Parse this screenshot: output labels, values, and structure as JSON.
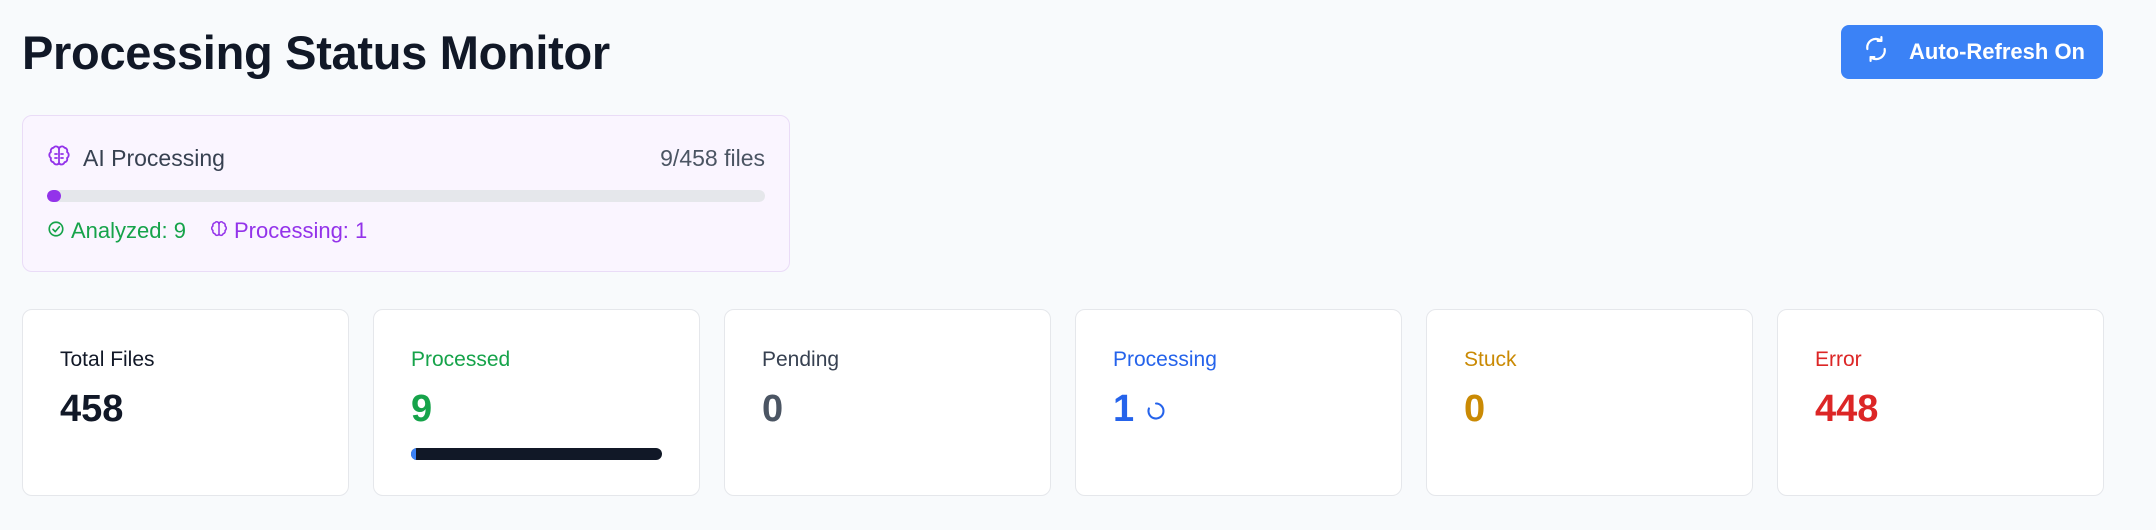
{
  "header": {
    "title": "Processing Status Monitor",
    "refresh_button": {
      "label": "Auto-Refresh On",
      "icon": "refresh-icon"
    }
  },
  "ai_processing": {
    "title": "AI Processing",
    "icon": "brain-icon",
    "count": "9/458 files",
    "progress": 0.0197,
    "analyzed_label": "Analyzed: 9",
    "processing_label": "Processing: 1"
  },
  "stats": {
    "total": {
      "label": "Total Files",
      "value": "458"
    },
    "processed": {
      "label": "Processed",
      "value": "9",
      "progress": 0.0197
    },
    "pending": {
      "label": "Pending",
      "value": "0"
    },
    "processing": {
      "label": "Processing",
      "value": "1"
    },
    "stuck": {
      "label": "Stuck",
      "value": "0"
    },
    "error": {
      "label": "Error",
      "value": "448"
    }
  },
  "colors": {
    "accent": "#3b82f6",
    "ai_purple": "#9333ea",
    "success": "#16a34a",
    "info": "#2563eb",
    "warning": "#ca8a04",
    "danger": "#dc2626"
  }
}
